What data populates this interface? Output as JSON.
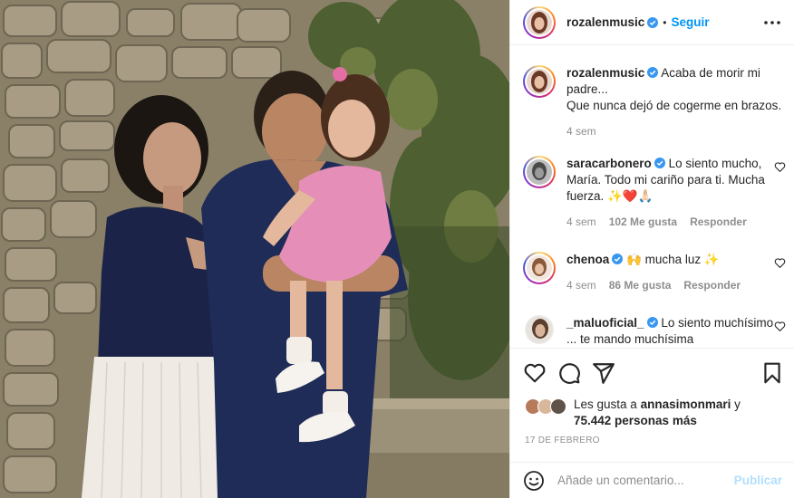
{
  "post": {
    "author": "rozalenmusic",
    "dot": "•",
    "follow_label": "Seguir",
    "more_icon": "more-horizontal-icon"
  },
  "caption": {
    "author": "rozalenmusic",
    "text_line1": "Acaba de morir mi padre...",
    "text_line2": "Que nunca dejó de cogerme en brazos.",
    "time": "4 sem"
  },
  "comments": [
    {
      "author": "saracarbonero",
      "text": "Lo siento mucho, María. Todo mi cariño para ti. Mucha fuerza. ✨❤️🙏🏻",
      "time": "4 sem",
      "likes": "102 Me gusta",
      "reply": "Responder"
    },
    {
      "author": "chenoa",
      "text": "🙌 mucha luz ✨",
      "time": "4 sem",
      "likes": "86 Me gusta",
      "reply": "Responder"
    },
    {
      "author": "_maluoficial_",
      "text": "Lo siento muchísimo ... te mando muchísima"
    }
  ],
  "likes": {
    "prefix": "Les gusta a ",
    "user": "annasimonmari",
    "middle": " y",
    "count": "75.442 personas más"
  },
  "date": "17 DE FEBRERO",
  "add_comment": {
    "placeholder": "Añade un comentario...",
    "publish_label": "Publicar"
  },
  "colors": {
    "accent": "#0095f6",
    "publish_disabled": "#b2dffc",
    "verified": "#3897f0",
    "heart": "#e0245e"
  }
}
